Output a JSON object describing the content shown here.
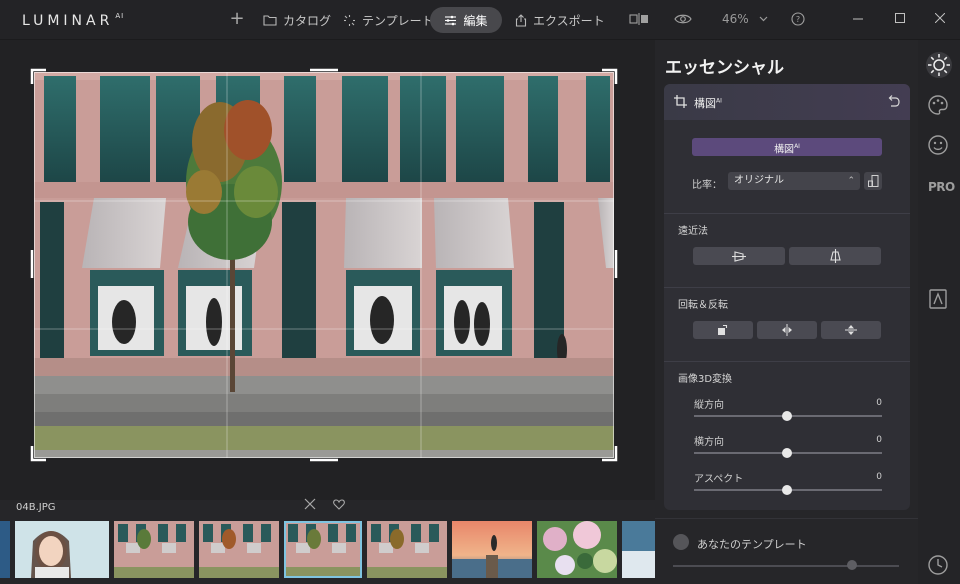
{
  "app": {
    "logo": "LUMINAR",
    "logo_sup": "AI"
  },
  "toolbar": {
    "add_icon": "plus-icon",
    "catalog_label": "カタログ",
    "templates_label": "テンプレート",
    "edit_label": "編集",
    "export_label": "エクスポート",
    "zoom_value": "46%"
  },
  "panel": {
    "title": "エッセンシャル",
    "tool": {
      "name": "構図",
      "name_sup": "AI"
    },
    "compose_button": "構図",
    "compose_button_sup": "AI",
    "ratio_label": "比率：",
    "ratio_value": "オリジナル",
    "perspective_label": "遠近法",
    "rotate_label": "回転＆反転",
    "transform3d_label": "画像3D変換",
    "sliders": [
      {
        "label": "縦方向",
        "value": "0",
        "level": 0.5
      },
      {
        "label": "横方向",
        "value": "0",
        "level": 0.5
      },
      {
        "label": "アスペクト",
        "value": "0",
        "level": 0.5
      }
    ]
  },
  "bottom": {
    "templates_label": "あなたのテンプレート"
  },
  "filmstrip": {
    "filename": "04B.JPG",
    "selected_index": 4
  },
  "colors": {
    "accent": "#5c4a7c",
    "selection": "#7fc4e0"
  }
}
